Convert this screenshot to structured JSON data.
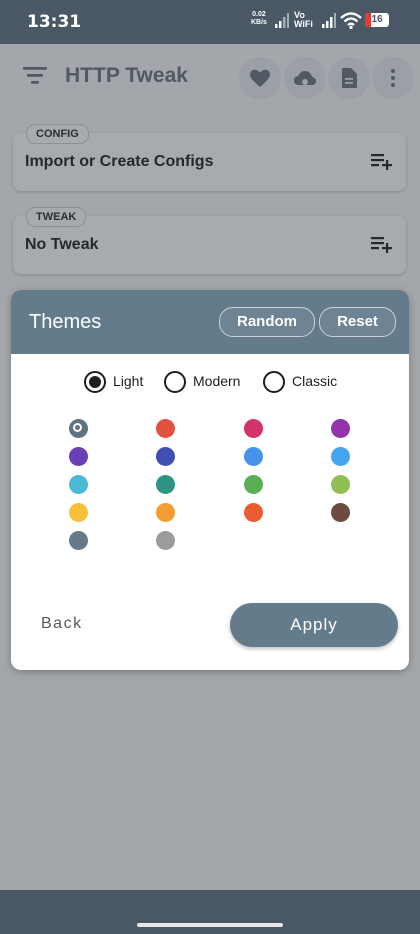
{
  "status_bar": {
    "time": "13:31",
    "net_speed_value": "0.02",
    "net_speed_unit": "KB/s",
    "vo_label": "Vo",
    "wifi_label": "WiFi",
    "battery": "16",
    "battery_color": "#e53935"
  },
  "app": {
    "title": "HTTP Tweak",
    "actions": [
      "heart-icon",
      "cloud-icon",
      "document-icon",
      "more-vert-icon"
    ],
    "sections": [
      {
        "tag": "CONFIG",
        "text": "Import or Create Configs",
        "icon": "playlist-add-icon"
      },
      {
        "tag": "TWEAK",
        "text": "No Tweak",
        "icon": "playlist-add-icon"
      }
    ]
  },
  "dialog": {
    "title": "Themes",
    "random_label": "Random",
    "reset_label": "Reset",
    "modes": [
      {
        "label": "Light",
        "selected": true
      },
      {
        "label": "Modern",
        "selected": false
      },
      {
        "label": "Classic",
        "selected": false
      }
    ],
    "swatches": [
      {
        "color": "#5f7381",
        "selected": true
      },
      {
        "color": "#e0523f",
        "selected": false
      },
      {
        "color": "#d6326a",
        "selected": false
      },
      {
        "color": "#9334aa",
        "selected": false
      },
      {
        "color": "#6a3eb4",
        "selected": false
      },
      {
        "color": "#3f4fb2",
        "selected": false
      },
      {
        "color": "#4593ea",
        "selected": false
      },
      {
        "color": "#45a5ee",
        "selected": false
      },
      {
        "color": "#4bb8d6",
        "selected": false
      },
      {
        "color": "#2e9585",
        "selected": false
      },
      {
        "color": "#5aae54",
        "selected": false
      },
      {
        "color": "#8fbf52",
        "selected": false
      },
      {
        "color": "#f5c13a",
        "selected": false
      },
      {
        "color": "#f29e33",
        "selected": false
      },
      {
        "color": "#ec5c31",
        "selected": false
      },
      {
        "color": "#6e4b40",
        "selected": false
      },
      {
        "color": "#667a8a",
        "selected": false
      },
      {
        "color": "#9b9b9b",
        "selected": false
      }
    ],
    "back_label": "Back",
    "apply_label": "Apply"
  },
  "colors": {
    "accent": "#647b8b",
    "status_bar": "#4a5866"
  }
}
